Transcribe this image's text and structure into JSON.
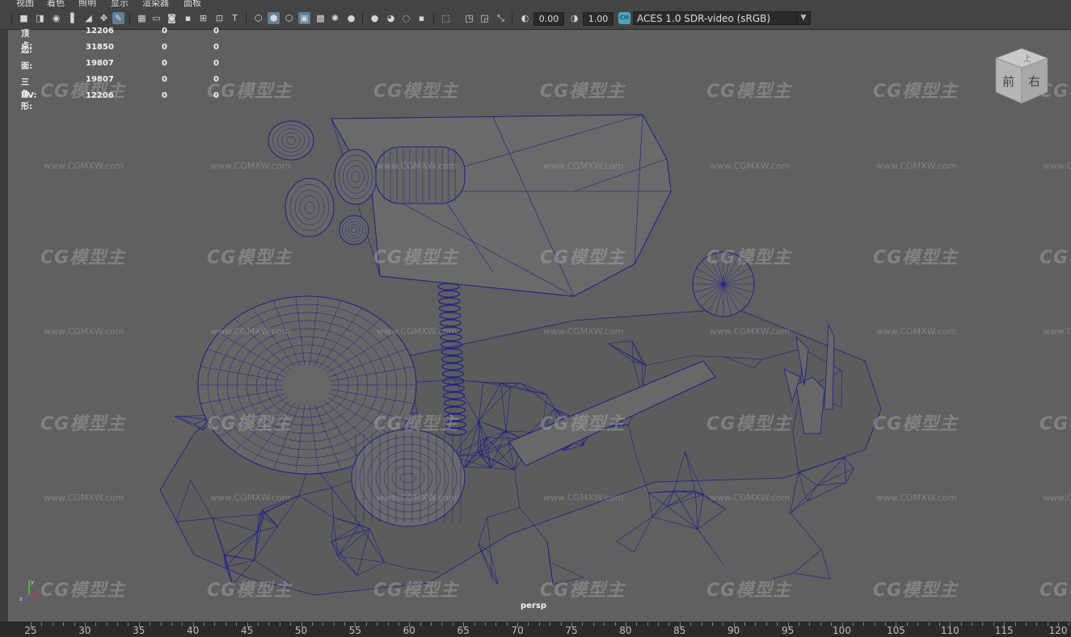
{
  "menu": [
    "视图",
    "着色",
    "照明",
    "显示",
    "渲染器",
    "面板"
  ],
  "toolbar": {
    "icons_group1": [
      "camera-icon",
      "camera-attr-icon",
      "bookmark-camera-icon",
      "bookmark-icon",
      "image-plane-icon",
      "grease-pencil-icon"
    ],
    "icons_group2": [
      "grid-icon",
      "film-gate-icon",
      "resolution-gate-icon",
      "gate-mask-icon",
      "field-chart-icon",
      "safe-action-icon",
      "safe-title-icon"
    ],
    "icons_group3": [
      "wireframe-icon",
      "smooth-shade-icon",
      "wireframe-on-shaded-icon",
      "default-material-icon",
      "textured-icon",
      "use-lights-icon",
      "shadows-icon"
    ],
    "icons_group4": [
      "screen-space-ao-icon",
      "motion-blur-icon",
      "anti-aliasing-icon",
      "depth-of-field-icon"
    ],
    "icons_group5": [
      "isolate-select-icon",
      "xray-icon",
      "xray-joints-icon",
      "backface-icon"
    ],
    "exposure_value": "0.00",
    "gamma_value": "1.00",
    "color_space": "ACES 1.0 SDR-video (sRGB)"
  },
  "hud": {
    "rows": [
      {
        "label": "顶点:",
        "v1": "12206",
        "v2": "0",
        "v3": "0"
      },
      {
        "label": "边:",
        "v1": "31850",
        "v2": "0",
        "v3": "0"
      },
      {
        "label": "面:",
        "v1": "19807",
        "v2": "0",
        "v3": "0"
      },
      {
        "label": "三角形:",
        "v1": "19807",
        "v2": "0",
        "v3": "0"
      },
      {
        "label": "UV:",
        "v1": "12206",
        "v2": "0",
        "v3": "0"
      }
    ]
  },
  "viewcube": {
    "top": "上",
    "front": "前",
    "right": "右"
  },
  "watermark": {
    "logo": "CG模型主",
    "url": "www.CGMXW.com"
  },
  "camera_label": "persp",
  "axis": {
    "x": "x",
    "y": "y",
    "z": "z"
  },
  "ruler": [
    "25",
    "30",
    "35",
    "40",
    "45",
    "50",
    "55",
    "60",
    "65",
    "70",
    "75",
    "80",
    "85",
    "90",
    "95",
    "100",
    "105",
    "110",
    "115",
    "120"
  ],
  "colors": {
    "wire": "#1e1e8c",
    "viewport_bg": "#606060",
    "active_icon": "#5d7f99"
  }
}
